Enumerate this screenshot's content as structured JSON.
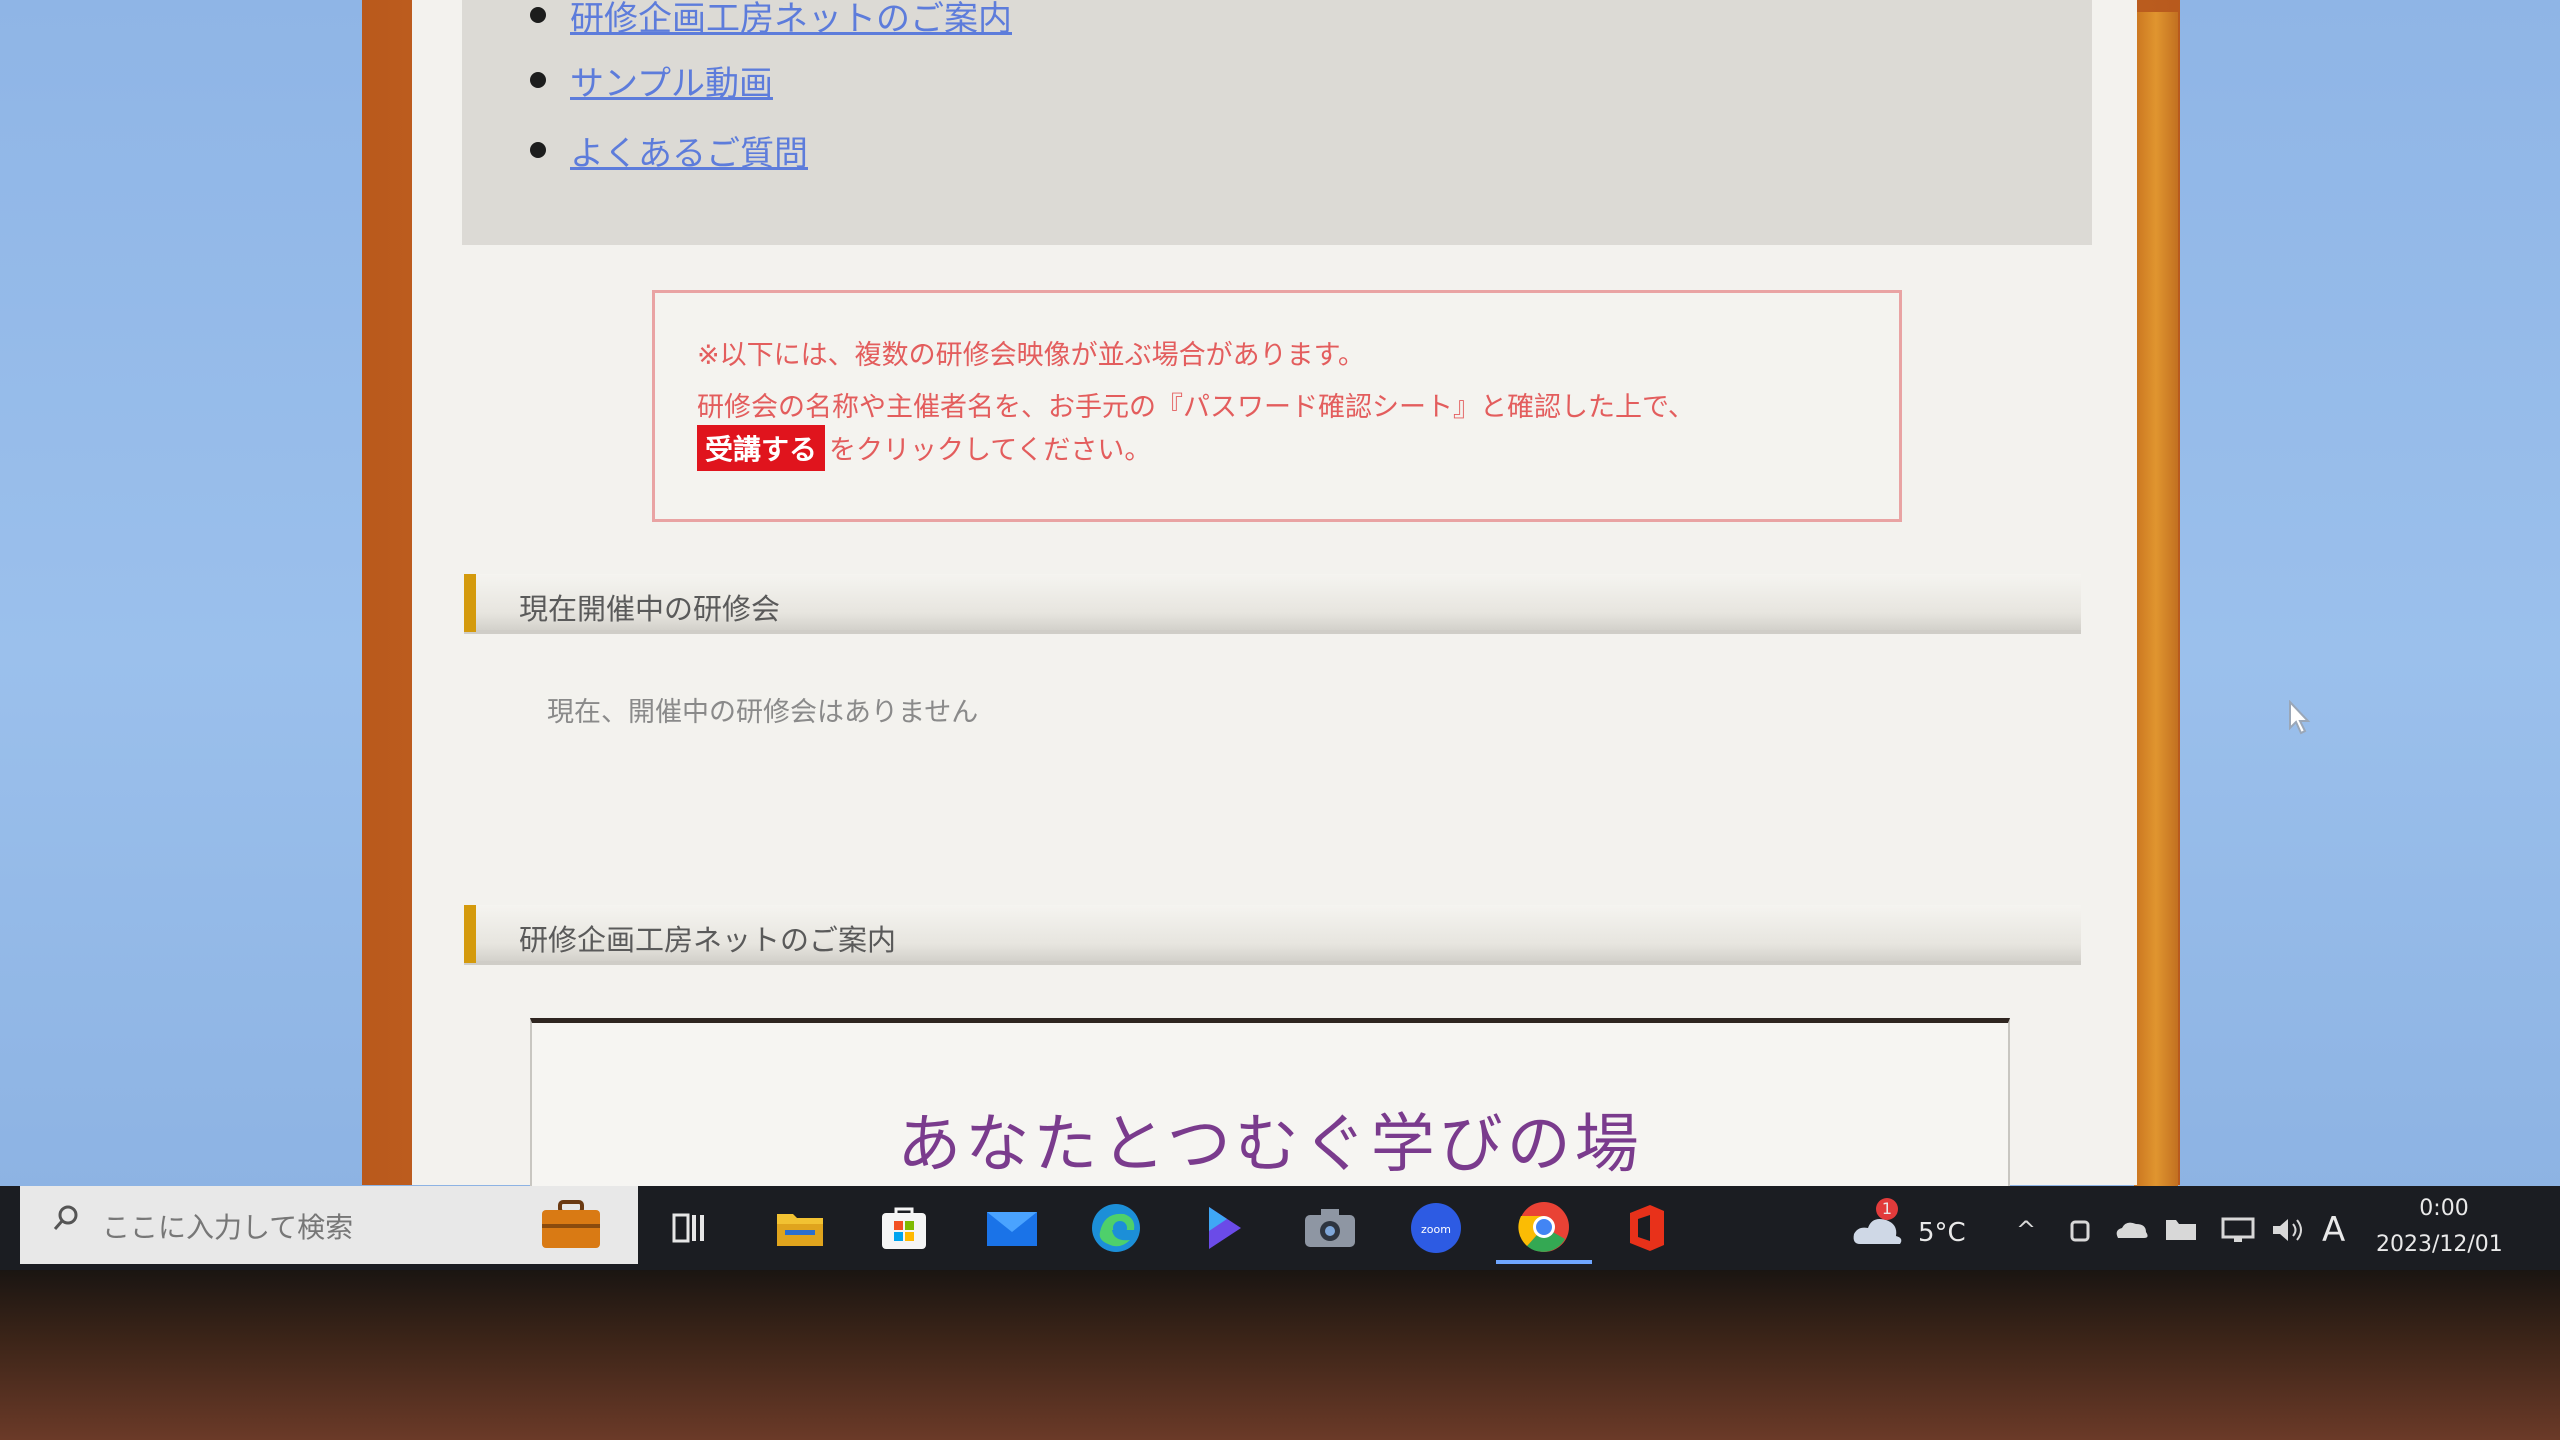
{
  "links": [
    "研修企画工房ネットのご案内",
    "サンプル動画",
    "よくあるご質問"
  ],
  "notice": {
    "line1": "※以下には、複数の研修会映像が並ぶ場合があります。",
    "line2": "研修会の名称や主催者名を、お手元の『パスワード確認シート』と確認した上で、",
    "button_label": "受講する",
    "line3_suffix": "をクリックしてください。"
  },
  "sections": {
    "current": {
      "title": "現在開催中の研修会",
      "empty_message": "現在、開催中の研修会はありません"
    },
    "about": {
      "title": "研修企画工房ネットのご案内"
    }
  },
  "promo": {
    "headline": "あなたとつむぐ学びの場"
  },
  "taskbar": {
    "search_placeholder": "ここに入力して検索",
    "apps": [
      "task-view-icon",
      "file-explorer-icon",
      "microsoft-store-icon",
      "mail-icon",
      "edge-icon",
      "media-player-icon",
      "camera-icon",
      "zoom-icon",
      "chrome-icon",
      "office-icon"
    ],
    "weather_temp": "5°C",
    "weather_badge": "1",
    "ime": "A",
    "time": "0:00",
    "date": "2023/12/01"
  },
  "colors": {
    "accent_bar": "#d49a0c",
    "notice_red": "#e35d5d",
    "button_red": "#e0141d",
    "link_blue": "#5d7cdb",
    "promo_purple": "#7a3b8d"
  }
}
